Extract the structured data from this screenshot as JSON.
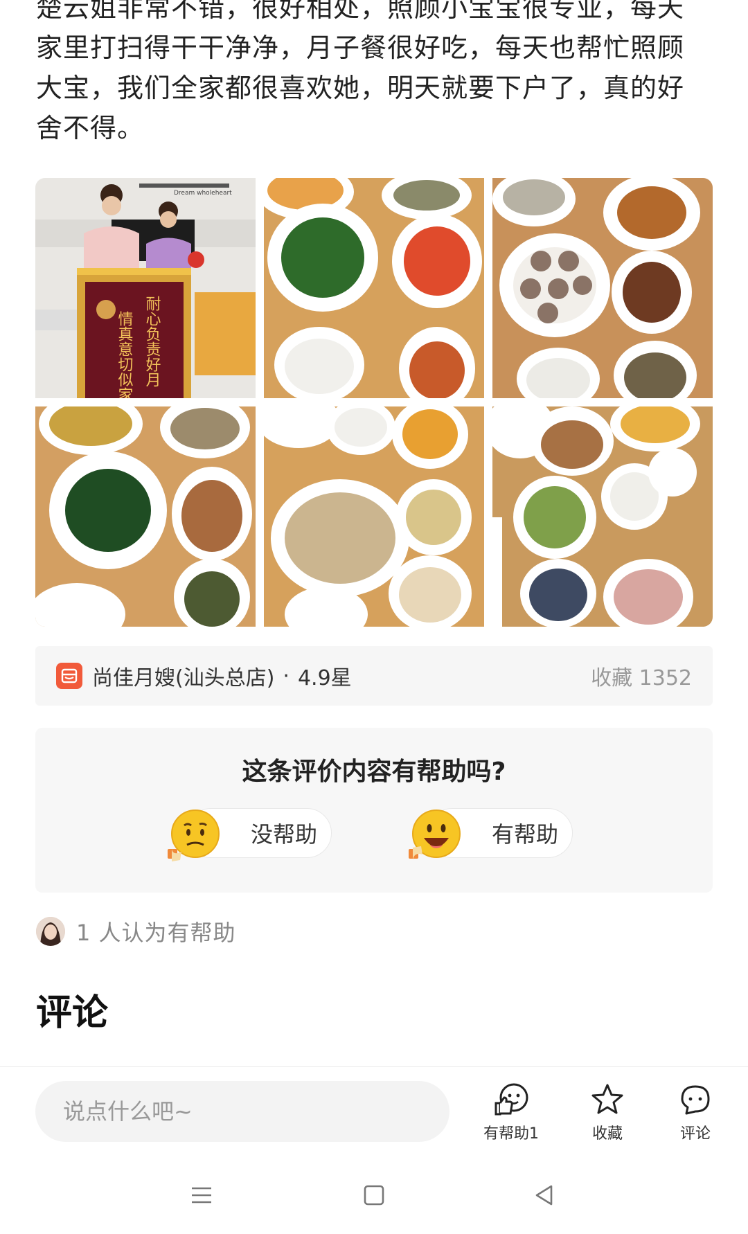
{
  "review": {
    "text": "楚云姐非常不错，很好相处，照顾小宝宝很专业，每天家里打扫得干干净净，月子餐很好吃，每天也帮忙照顾大宝，我们全家都很喜欢她，明天就要下户了，真的好舍不得。"
  },
  "photos": [
    {
      "name": "photo-banner-nanny"
    },
    {
      "name": "photo-meal-1"
    },
    {
      "name": "photo-meal-2"
    },
    {
      "name": "photo-meal-3"
    },
    {
      "name": "photo-meal-4"
    },
    {
      "name": "photo-meal-5"
    }
  ],
  "banner_text": {
    "left": "情真意切似家",
    "right": "耐心负责好月",
    "wall": "Dream wholeheart"
  },
  "shop": {
    "name": "尚佳月嫂(汕头总店)",
    "separator": "·",
    "rating": "4.9星",
    "favorites": "收藏 1352",
    "icon": "shop-icon",
    "icon_color": "#f15a3a"
  },
  "helpful_prompt": {
    "question": "这条评价内容有帮助吗?",
    "not_helpful": "没帮助",
    "helpful": "有帮助"
  },
  "helpful_count": {
    "text": "1 人认为有帮助"
  },
  "comments": {
    "title": "评论"
  },
  "bottom_bar": {
    "input_placeholder": "说点什么吧~",
    "helpful_label": "有帮助1",
    "favorite_label": "收藏",
    "comment_label": "评论"
  },
  "nav": {
    "menu_icon": "menu-icon",
    "home_icon": "home-icon",
    "back_icon": "back-icon"
  }
}
